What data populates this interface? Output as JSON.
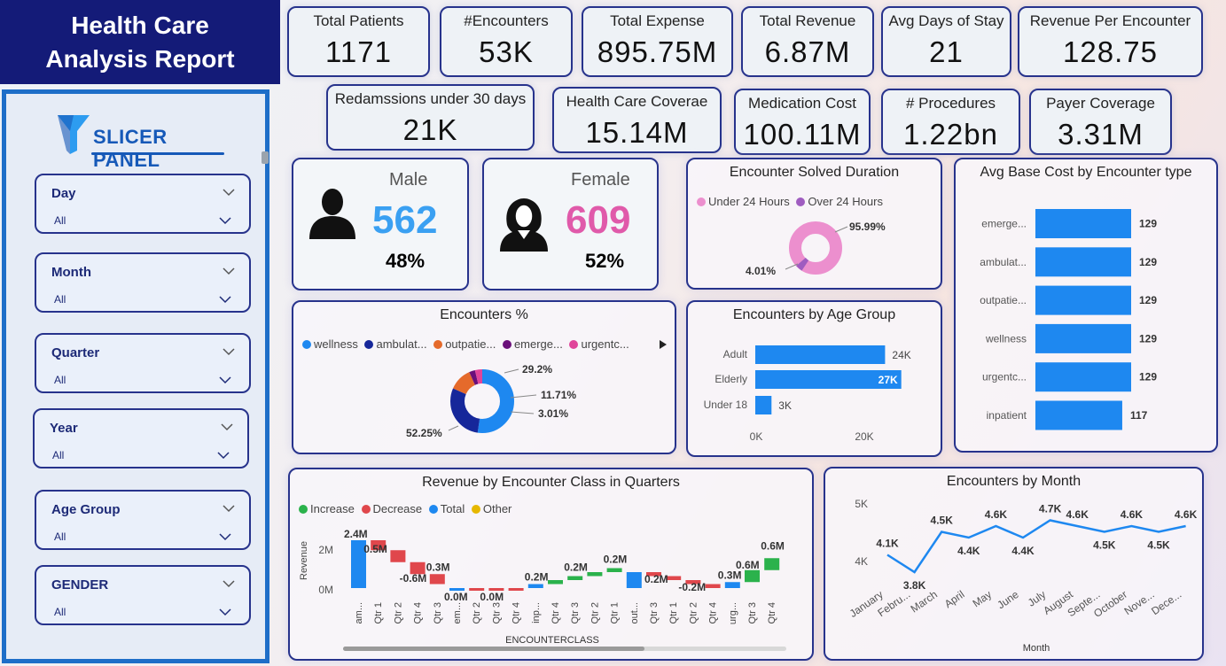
{
  "title": {
    "line1": "Health Care",
    "line2": "Analysis Report"
  },
  "slicer_panel": {
    "heading": "SLICER PANEL",
    "slicers": [
      {
        "label": "Day",
        "value": "All"
      },
      {
        "label": "Month",
        "value": "All"
      },
      {
        "label": "Quarter",
        "value": "All"
      },
      {
        "label": "Year",
        "value": "All"
      },
      {
        "label": "Age Group",
        "value": "All"
      },
      {
        "label": "GENDER",
        "value": "All"
      }
    ]
  },
  "kpis": [
    {
      "label": "Total Patients",
      "value": "1171"
    },
    {
      "label": "#Encounters",
      "value": "53K"
    },
    {
      "label": "Total Expense",
      "value": "895.75M"
    },
    {
      "label": "Total Revenue",
      "value": "6.87M"
    },
    {
      "label": "Avg Days of Stay",
      "value": "21"
    },
    {
      "label": "Revenue Per Encounter",
      "value": "128.75"
    },
    {
      "label": "Redamssions under 30 days",
      "value": "21K"
    },
    {
      "label": "Health Care Coverae",
      "value": "15.14M"
    },
    {
      "label": "Medication Cost",
      "value": "100.11M"
    },
    {
      "label": "# Procedures",
      "value": "1.22bn"
    },
    {
      "label": "Payer Coverage",
      "value": "3.31M"
    }
  ],
  "gender": {
    "male": {
      "label": "Male",
      "count": "562",
      "pct": "48%",
      "color": "#3aa0f2"
    },
    "female": {
      "label": "Female",
      "count": "609",
      "pct": "52%",
      "color": "#e05aaa"
    }
  },
  "solved_duration": {
    "title": "Encounter Solved Duration",
    "legend": [
      "Under 24 Hours",
      "Over 24 Hours"
    ],
    "colors": [
      "#ec8fce",
      "#9f5cc0"
    ],
    "labels": [
      "95.99%",
      "4.01%"
    ]
  },
  "avg_base_cost": {
    "title": "Avg Base Cost by Encounter type",
    "categories": [
      "emerge...",
      "ambulat...",
      "outpatie...",
      "wellness",
      "urgentc...",
      "inpatient"
    ],
    "values": [
      129,
      129,
      129,
      129,
      129,
      117
    ],
    "value_labels": [
      "129",
      "129",
      "129",
      "129",
      "129",
      "117"
    ],
    "color": "#1e88f0"
  },
  "encounters_pct": {
    "title": "Encounters %",
    "legend": [
      "wellness",
      "ambulat...",
      "outpatie...",
      "emerge...",
      "urgentc..."
    ],
    "colors": [
      "#1e88f0",
      "#16279a",
      "#e56a2b",
      "#6a0f7a",
      "#e0449a"
    ],
    "labels": [
      "52.25%",
      "29.2%",
      "11.71%",
      "3.01%"
    ]
  },
  "age_group": {
    "title": "Encounters by Age Group",
    "categories": [
      "Adult",
      "Elderly",
      "Under 18"
    ],
    "value_labels": [
      "24K",
      "27K",
      "3K"
    ],
    "axis_labels": [
      "0K",
      "20K"
    ],
    "color": "#1e88f0"
  },
  "waterfall": {
    "title": "Revenue by Encounter Class in Quarters",
    "legend": [
      "Increase",
      "Decrease",
      "Total",
      "Other"
    ],
    "legend_colors": [
      "#2bb24c",
      "#e0474c",
      "#1e88f0",
      "#e6b800"
    ],
    "ylabel": "Revenue",
    "xlabel": "ENCOUNTERCLASS",
    "yticks": [
      "2M",
      "0M"
    ],
    "xticks": [
      "am...",
      "Qtr 1",
      "Qtr 2",
      "Qtr 4",
      "Qtr 3",
      "em...",
      "Qtr 2",
      "Qtr 3",
      "Qtr 4",
      "inp...",
      "Qtr 4",
      "Qtr 3",
      "Qtr 2",
      "Qtr 1",
      "out...",
      "Qtr 3",
      "Qtr 1",
      "Qtr 2",
      "Qtr 4",
      "urg...",
      "Qtr 3",
      "Qtr 4"
    ],
    "data_labels": [
      "2.4M",
      "0.5M",
      "-0.6M",
      "0.3M",
      "0.0M",
      "0.0M",
      "0.2M",
      "0.2M",
      "0.2M",
      "0.2M",
      "-0.2M",
      "0.3M",
      "0.6M",
      "0.6M"
    ]
  },
  "by_month": {
    "title": "Encounters by Month",
    "xlabel": "Month",
    "yticks": [
      "5K",
      "4K"
    ],
    "months": [
      "January",
      "Febru...",
      "March",
      "April",
      "May",
      "June",
      "July",
      "August",
      "Septe...",
      "October",
      "Nove...",
      "Dece..."
    ],
    "value_labels": [
      "4.1K",
      "3.8K",
      "4.5K",
      "4.4K",
      "4.6K",
      "4.4K",
      "4.7K",
      "4.6K",
      "4.5K",
      "4.6K",
      "4.5K",
      "4.6K"
    ],
    "color": "#1e88f0"
  },
  "chart_data": [
    {
      "type": "pie",
      "title": "Encounter Solved Duration",
      "categories": [
        "Under 24 Hours",
        "Over 24 Hours"
      ],
      "values": [
        95.99,
        4.01
      ]
    },
    {
      "type": "bar",
      "title": "Avg Base Cost by Encounter type",
      "categories": [
        "emerge...",
        "ambulat...",
        "outpatie...",
        "wellness",
        "urgentc...",
        "inpatient"
      ],
      "values": [
        129,
        129,
        129,
        129,
        129,
        117
      ]
    },
    {
      "type": "pie",
      "title": "Encounters %",
      "categories": [
        "wellness",
        "ambulat...",
        "outpatie...",
        "emerge...",
        "urgentc..."
      ],
      "values": [
        52.25,
        29.2,
        11.71,
        3.01,
        3.83
      ]
    },
    {
      "type": "bar",
      "title": "Encounters by Age Group",
      "categories": [
        "Adult",
        "Elderly",
        "Under 18"
      ],
      "values": [
        24,
        27,
        3
      ],
      "xlim": [
        0,
        30
      ]
    },
    {
      "type": "bar",
      "title": "Revenue by Encounter Class in Quarters",
      "xlabel": "ENCOUNTERCLASS",
      "ylabel": "Revenue",
      "categories": [
        "am...",
        "Qtr 1",
        "Qtr 2",
        "Qtr 4",
        "Qtr 3",
        "em...",
        "Qtr 2",
        "Qtr 3",
        "Qtr 4",
        "inp...",
        "Qtr 4",
        "Qtr 3",
        "Qtr 2",
        "Qtr 1",
        "out...",
        "Qtr 3",
        "Qtr 1",
        "Qtr 2",
        "Qtr 4",
        "urg...",
        "Qtr 3",
        "Qtr 4"
      ],
      "values": [
        2.4,
        -0.5,
        -0.6,
        -0.6,
        -0.5,
        0.0,
        0.0,
        0.0,
        0.0,
        0.2,
        0.2,
        0.2,
        0.2,
        0.2,
        0.8,
        -0.2,
        -0.2,
        -0.2,
        -0.2,
        0.3,
        0.6,
        0.6
      ],
      "kinds": [
        "total",
        "decrease",
        "decrease",
        "decrease",
        "decrease",
        "total",
        "decrease",
        "decrease",
        "decrease",
        "total",
        "increase",
        "increase",
        "increase",
        "increase",
        "total",
        "decrease",
        "decrease",
        "decrease",
        "decrease",
        "total",
        "increase",
        "increase"
      ],
      "ylim": [
        0,
        2.6
      ]
    },
    {
      "type": "line",
      "title": "Encounters by Month",
      "xlabel": "Month",
      "x": [
        "January",
        "Febru...",
        "March",
        "April",
        "May",
        "June",
        "July",
        "August",
        "Septe...",
        "October",
        "Nove...",
        "Dece..."
      ],
      "values": [
        4.1,
        3.8,
        4.5,
        4.4,
        4.6,
        4.4,
        4.7,
        4.6,
        4.5,
        4.6,
        4.5,
        4.6
      ],
      "ylim": [
        3.6,
        5.0
      ]
    }
  ]
}
